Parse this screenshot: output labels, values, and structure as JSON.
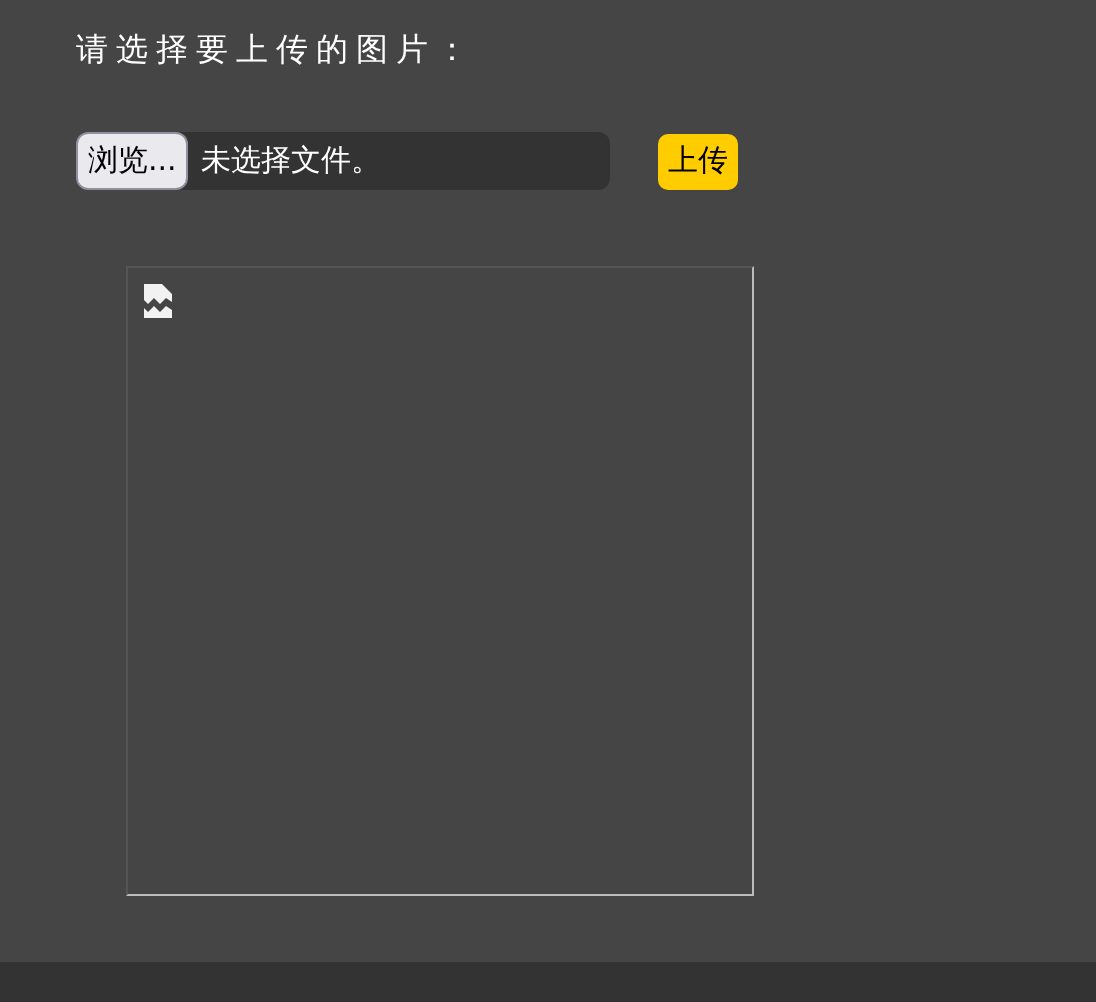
{
  "heading": "请选择要上传的图片：",
  "file_input": {
    "button": "浏览...",
    "status": "未选择文件。"
  },
  "upload_button": "上传",
  "preview": {
    "broken": true
  }
}
